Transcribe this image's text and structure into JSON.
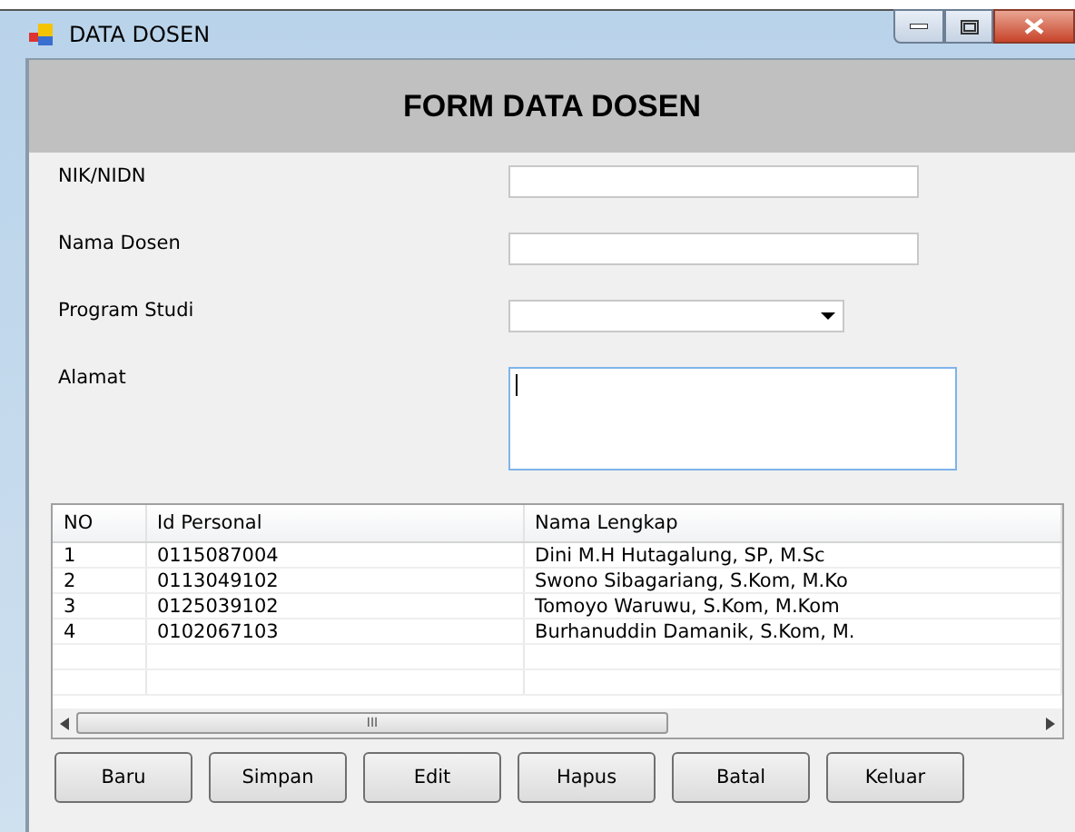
{
  "window": {
    "title": "DATA DOSEN"
  },
  "header": {
    "title": "FORM DATA DOSEN"
  },
  "fields": [
    {
      "label": "NIK/NIDN",
      "kind": "text",
      "focused": false
    },
    {
      "label": "Nama Dosen",
      "kind": "text",
      "focused": false
    },
    {
      "label": "Program Studi",
      "kind": "dropdown",
      "focused": false
    },
    {
      "label": "Alamat",
      "kind": "textarea",
      "focused": true
    }
  ],
  "table": {
    "columns": [
      "NO",
      "Id Personal",
      "Nama Lengkap"
    ],
    "rows": [
      [
        "1",
        "0115087004",
        "Dini M.H Hutagalung, SP, M.Sc"
      ],
      [
        "2",
        "0113049102",
        "Swono Sibagariang, S.Kom, M.Ko"
      ],
      [
        "3",
        "0125039102",
        "Tomoyo Waruwu, S.Kom, M.Kom"
      ],
      [
        "4",
        "0102067103",
        "Burhanuddin Damanik, S.Kom, M."
      ]
    ],
    "scroll_grip": "III"
  },
  "buttons": [
    "Baru",
    "Simpan",
    "Edit",
    "Hapus",
    "Batal",
    "Keluar"
  ]
}
